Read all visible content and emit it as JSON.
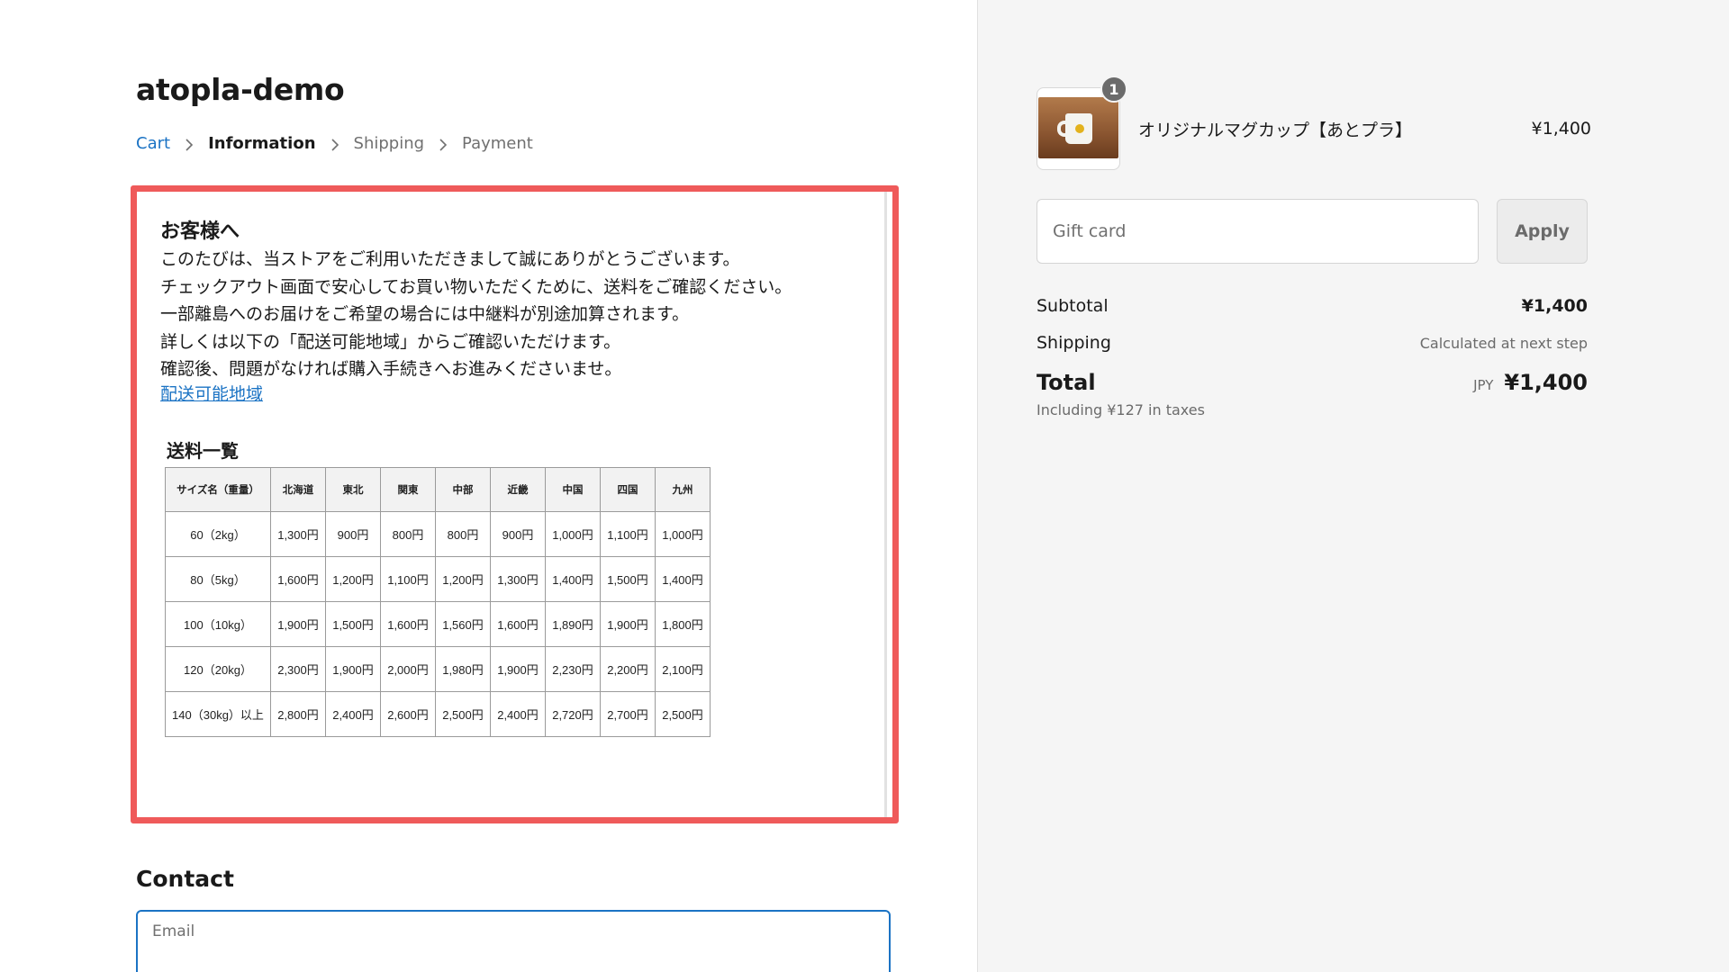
{
  "store": {
    "title": "atopla-demo"
  },
  "breadcrumb": [
    {
      "label": "Cart"
    },
    {
      "label": "Information"
    },
    {
      "label": "Shipping"
    },
    {
      "label": "Payment"
    }
  ],
  "notice": {
    "heading": "お客様へ",
    "lines": [
      "このたびは、当ストアをご利用いただきまして誠にありがとうございます。",
      "チェックアウト画面で安心してお買い物いただくために、送料をご確認ください。",
      "一部離島へのお届けをご希望の場合には中継料が別途加算されます。",
      "詳しくは以下の「配送可能地域」からご確認いただけます。",
      "確認後、問題がなければ購入手続きへお進みくださいませ。"
    ],
    "link": "配送可能地域",
    "table_title": "送料一覧",
    "table": {
      "headers": [
        "サイズ名（重量）",
        "北海道",
        "東北",
        "関東",
        "中部",
        "近畿",
        "中国",
        "四国",
        "九州"
      ],
      "rows": [
        [
          "60（2kg）",
          "1,300円",
          "900円",
          "800円",
          "800円",
          "900円",
          "1,000円",
          "1,100円",
          "1,000円"
        ],
        [
          "80（5kg）",
          "1,600円",
          "1,200円",
          "1,100円",
          "1,200円",
          "1,300円",
          "1,400円",
          "1,500円",
          "1,400円"
        ],
        [
          "100（10kg）",
          "1,900円",
          "1,500円",
          "1,600円",
          "1,560円",
          "1,600円",
          "1,890円",
          "1,900円",
          "1,800円"
        ],
        [
          "120（20kg）",
          "2,300円",
          "1,900円",
          "2,000円",
          "1,980円",
          "1,900円",
          "2,230円",
          "2,200円",
          "2,100円"
        ],
        [
          "140（30kg）以上",
          "2,800円",
          "2,400円",
          "2,600円",
          "2,500円",
          "2,400円",
          "2,720円",
          "2,700円",
          "2,500円"
        ]
      ]
    }
  },
  "contact": {
    "title": "Contact",
    "email_placeholder": "Email"
  },
  "order": {
    "item": {
      "quantity": "1",
      "name": "オリジナルマグカップ【あとプラ】",
      "price": "¥1,400"
    },
    "gift_card": {
      "placeholder": "Gift card",
      "apply_label": "Apply"
    },
    "subtotal": {
      "label": "Subtotal",
      "value": "¥1,400"
    },
    "shipping": {
      "label": "Shipping",
      "value": "Calculated at next step"
    },
    "total": {
      "label": "Total",
      "currency": "JPY",
      "value": "¥1,400",
      "tax_note": "Including ¥127 in taxes"
    }
  },
  "colors": {
    "link": "#1b73c4",
    "highlight_border": "#ef5a5a",
    "sidebar_bg": "#f5f5f5"
  }
}
